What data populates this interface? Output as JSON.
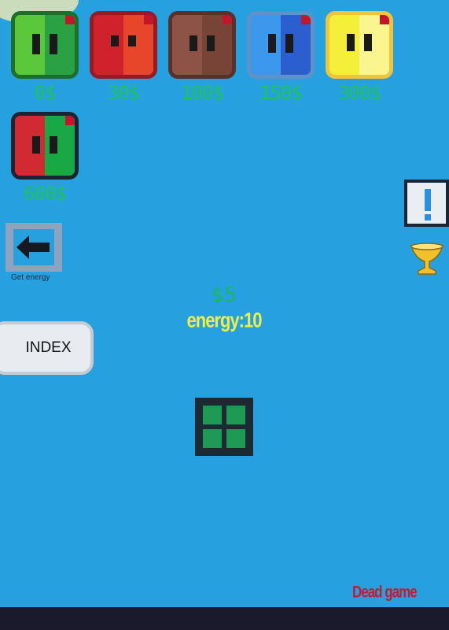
{
  "shop": {
    "skins": [
      {
        "price": "0$",
        "left": "#5ac83a",
        "right": "#2aa142",
        "border": "#1e6e2e"
      },
      {
        "price": "30$",
        "left": "#d0222c",
        "right": "#e8462a",
        "border": "#9a1a24"
      },
      {
        "price": "100$",
        "left": "#8c5346",
        "right": "#774437",
        "border": "#5a3128"
      },
      {
        "price": "150$",
        "left": "#3b98ec",
        "right": "#2b5fd0",
        "border": "#5f92c9"
      },
      {
        "price": "300$",
        "left": "#f4f03a",
        "right": "#fbf590",
        "border": "#f0c53c"
      },
      {
        "price": "600$",
        "left": "#d22a35",
        "right": "#18a846",
        "border": "#1b2532"
      }
    ]
  },
  "actions": {
    "get_energy_label": "Get energy",
    "index_label": "INDEX"
  },
  "hud": {
    "money": "$5",
    "energy": "energy:10"
  },
  "footer": {
    "dead_game": "Dead game"
  },
  "icons": {
    "arrow": "left-arrow-icon",
    "alert": "exclamation-icon",
    "trophy": "trophy-icon",
    "window": "window-icon"
  },
  "colors": {
    "background": "#27a0e0",
    "price_text": "#1cc45a",
    "energy_text": "#ecef4a",
    "dead_game_text": "#c21b34"
  }
}
